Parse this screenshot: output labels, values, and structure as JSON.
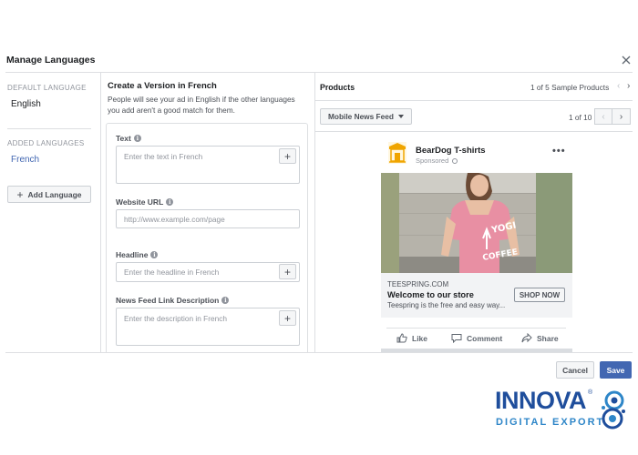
{
  "dialog": {
    "title": "Manage Languages"
  },
  "sidebar": {
    "default_label": "DEFAULT LANGUAGE",
    "default_language": "English",
    "added_label": "ADDED LANGUAGES",
    "added_languages": [
      "French"
    ],
    "add_button_label": "Add Language"
  },
  "form": {
    "title": "Create a Version in French",
    "description": "People will see your ad in English if the other languages you add aren't a good match for them.",
    "fields": {
      "text": {
        "label": "Text",
        "placeholder": "Enter the text in French"
      },
      "website_url": {
        "label": "Website URL",
        "placeholder": "http://www.example.com/page"
      },
      "headline": {
        "label": "Headline",
        "placeholder": "Enter the headline in French"
      },
      "link_description": {
        "label": "News Feed Link Description",
        "placeholder": "Enter the description in French"
      }
    }
  },
  "preview": {
    "products_label": "Products",
    "sample_count": "1 of 5 Sample Products",
    "placement": "Mobile News Feed",
    "page_count": "1 of 10",
    "ad": {
      "page_name": "BearDog T-shirts",
      "sponsored": "Sponsored",
      "shirt_text_top": "YOGI",
      "shirt_text_bottom": "COFFEE",
      "domain": "TEESPRING.COM",
      "headline": "Welcome to our store",
      "description": "Teespring is the free and easy way...",
      "cta": "SHOP NOW",
      "actions": [
        "Like",
        "Comment",
        "Share"
      ]
    }
  },
  "footer": {
    "cancel_label": "Cancel",
    "save_label": "Save"
  },
  "brand": {
    "name": "INNOVA",
    "tagline": "DIGITAL EXPORT",
    "reg_mark": "®"
  },
  "colors": {
    "accent": "#4267b2",
    "brand_dark": "#1f4e9c",
    "brand_light": "#2e86c8",
    "shirt_pink": "#e88fa3"
  }
}
